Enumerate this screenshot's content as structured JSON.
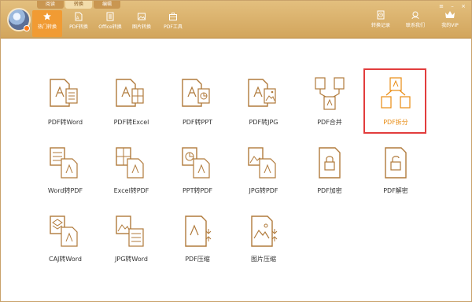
{
  "app": {
    "tabs": [
      "阅读",
      "转换",
      "编辑"
    ]
  },
  "nav": [
    {
      "label": "热门转换",
      "icon": "star-icon"
    },
    {
      "label": "PDF转换",
      "icon": "pdf-icon"
    },
    {
      "label": "Office转换",
      "icon": "office-icon"
    },
    {
      "label": "图片转换",
      "icon": "image-icon"
    },
    {
      "label": "PDF工具",
      "icon": "toolbox-icon"
    }
  ],
  "right_nav": [
    {
      "label": "转换记录",
      "icon": "history-icon"
    },
    {
      "label": "联系我们",
      "icon": "support-icon"
    },
    {
      "label": "我的VIP",
      "icon": "crown-icon"
    }
  ],
  "tools": [
    [
      {
        "label": "PDF转Word"
      },
      {
        "label": "PDF转Excel"
      },
      {
        "label": "PDF转PPT"
      },
      {
        "label": "PDF转JPG"
      },
      {
        "label": "PDF合并"
      },
      {
        "label": "PDF拆分",
        "selected": true
      }
    ],
    [
      {
        "label": "Word转PDF"
      },
      {
        "label": "Excel转PDF"
      },
      {
        "label": "PPT转PDF"
      },
      {
        "label": "JPG转PDF"
      },
      {
        "label": "PDF加密"
      },
      {
        "label": "PDF解密"
      }
    ],
    [
      {
        "label": "CAJ转Word"
      },
      {
        "label": "JPG转Word"
      },
      {
        "label": "PDF压缩"
      },
      {
        "label": "图片压缩"
      }
    ]
  ],
  "colors": {
    "accent": "#f19b33",
    "header": "#d9b06a",
    "icon": "#b07a3b",
    "selected": "#e88b12",
    "highlight_box": "#e23d3d"
  }
}
